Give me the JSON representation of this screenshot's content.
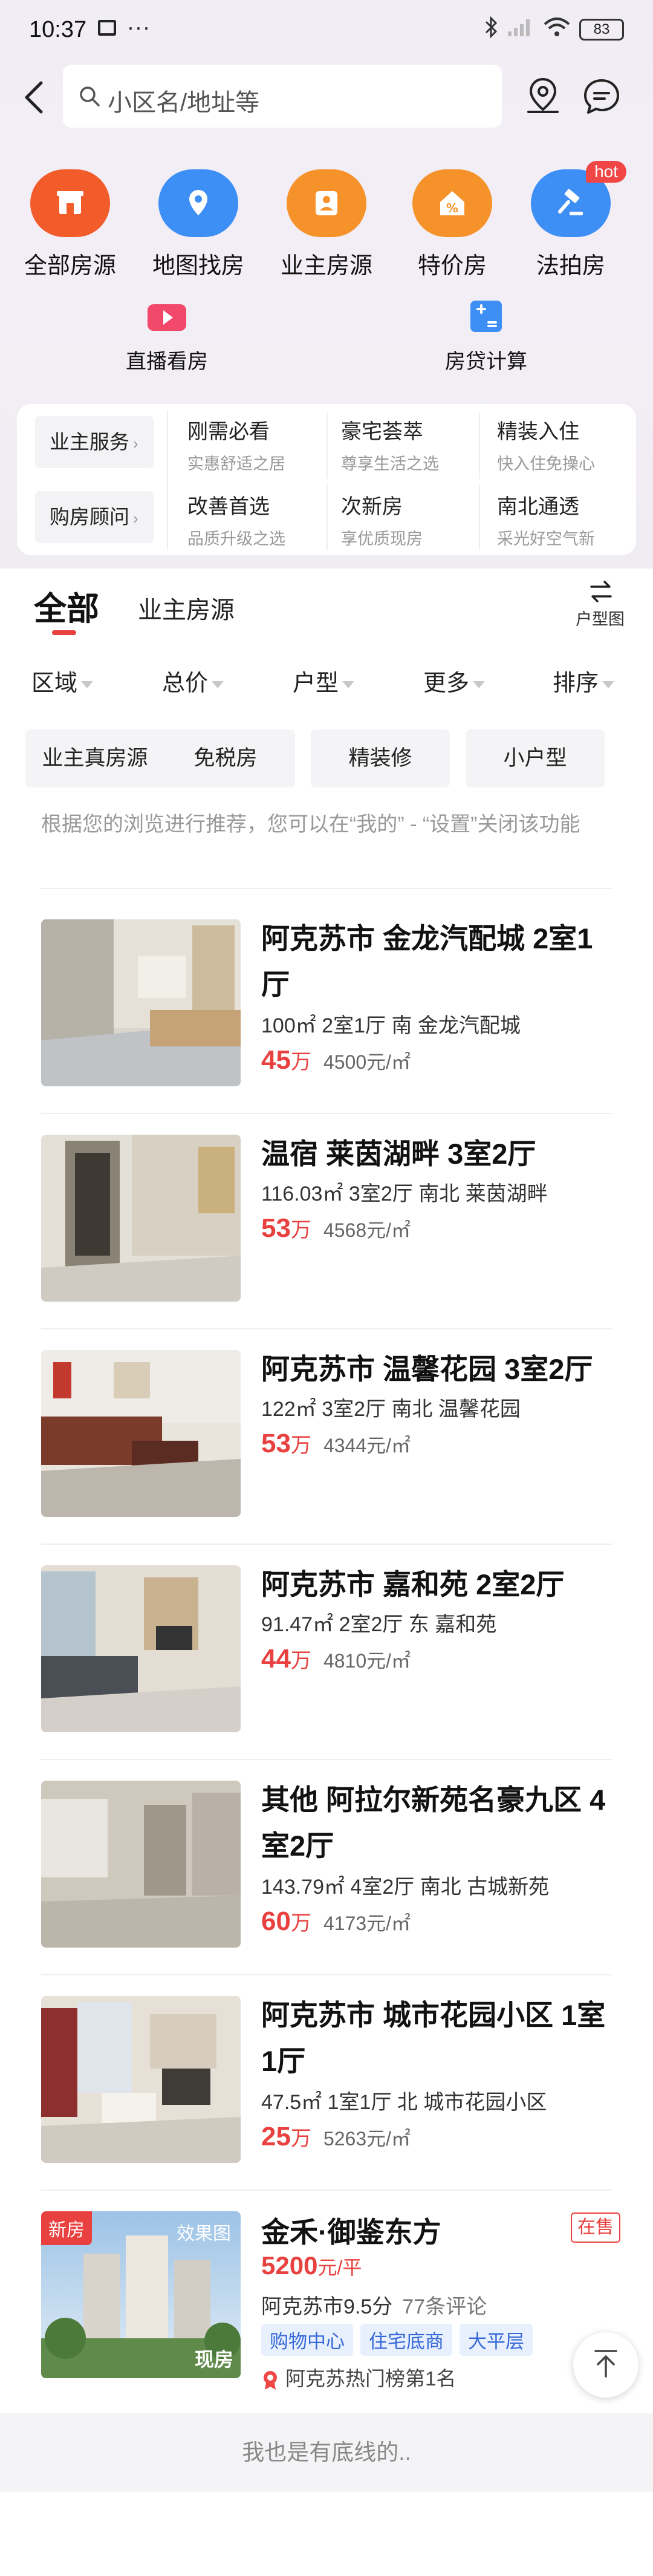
{
  "status_bar": {
    "time": "10:37",
    "dots": "···",
    "battery": "83"
  },
  "search": {
    "placeholder": "小区名/地址等"
  },
  "quick_nav": [
    {
      "label": "全部房源",
      "icon": "building-icon",
      "color": "#f25c2a"
    },
    {
      "label": "地图找房",
      "icon": "map-pin-icon",
      "color": "#3d8ef5"
    },
    {
      "label": "业主房源",
      "icon": "user-icon",
      "color": "#f6922a"
    },
    {
      "label": "特价房",
      "icon": "discount-icon",
      "color": "#f6922a"
    },
    {
      "label": "法拍房",
      "icon": "gavel-icon",
      "color": "#3d8ef5",
      "badge": "hot"
    }
  ],
  "quick_nav2": [
    {
      "label": "直播看房",
      "icon": "video-icon",
      "color": "#f2486a"
    },
    {
      "label": "房贷计算",
      "icon": "calculator-icon",
      "color": "#3d8ef5"
    }
  ],
  "services": {
    "row1_label": "业主服务",
    "row2_label": "购房顾问",
    "row1": [
      {
        "title": "刚需必看",
        "sub": "实惠舒适之居"
      },
      {
        "title": "豪宅荟萃",
        "sub": "尊享生活之选"
      },
      {
        "title": "精装入住",
        "sub": "快入住免操心"
      }
    ],
    "row2": [
      {
        "title": "改善首选",
        "sub": "品质升级之选"
      },
      {
        "title": "次新房",
        "sub": "享优质现房"
      },
      {
        "title": "南北通透",
        "sub": "采光好空气新"
      }
    ]
  },
  "tabs": {
    "all": "全部",
    "owner": "业主房源",
    "floor_plan": "户型图"
  },
  "filters": [
    "区域",
    "总价",
    "户型",
    "更多",
    "排序"
  ],
  "chips": [
    "业主真房源",
    "免税房",
    "精装修",
    "小户型"
  ],
  "notice": "根据您的浏览进行推荐，您可以在“我的” - “设置”关闭该功能",
  "listings": [
    {
      "title": "阿克苏市 金龙汽配城 2室1厅",
      "meta": "100㎡ 2室1厅 南 金龙汽配城",
      "price": "45",
      "price_unit": "万",
      "unit_price": "4500元/㎡"
    },
    {
      "title": "温宿 莱茵湖畔 3室2厅",
      "meta": "116.03㎡ 3室2厅 南北 莱茵湖畔",
      "price": "53",
      "price_unit": "万",
      "unit_price": "4568元/㎡"
    },
    {
      "title": "阿克苏市 温馨花园 3室2厅",
      "meta": "122㎡ 3室2厅 南北 温馨花园",
      "price": "53",
      "price_unit": "万",
      "unit_price": "4344元/㎡"
    },
    {
      "title": "阿克苏市 嘉和苑 2室2厅",
      "meta": "91.47㎡ 2室2厅 东 嘉和苑",
      "price": "44",
      "price_unit": "万",
      "unit_price": "4810元/㎡"
    },
    {
      "title": "其他 阿拉尔新苑名豪九区 4室2厅",
      "meta": "143.79㎡ 4室2厅 南北 古城新苑",
      "price": "60",
      "price_unit": "万",
      "unit_price": "4173元/㎡"
    },
    {
      "title": "阿克苏市 城市花园小区 1室1厅",
      "meta": "47.5㎡ 1室1厅 北 城市花园小区",
      "price": "25",
      "price_unit": "万",
      "unit_price": "5263元/㎡"
    }
  ],
  "new_project": {
    "badge": "新房",
    "photo_tag": "效果图",
    "photo_tag2": "现房",
    "title": "金禾·御鉴东方",
    "status": "在售",
    "price": "5200",
    "price_unit": "元/平",
    "district": "阿克苏市",
    "score": "9.5分",
    "comments": "77条评论",
    "tags": [
      "购物中心",
      "住宅底商",
      "大平层"
    ],
    "rank": "阿克苏热门榜第1名"
  },
  "footer": "我也是有底线的.."
}
